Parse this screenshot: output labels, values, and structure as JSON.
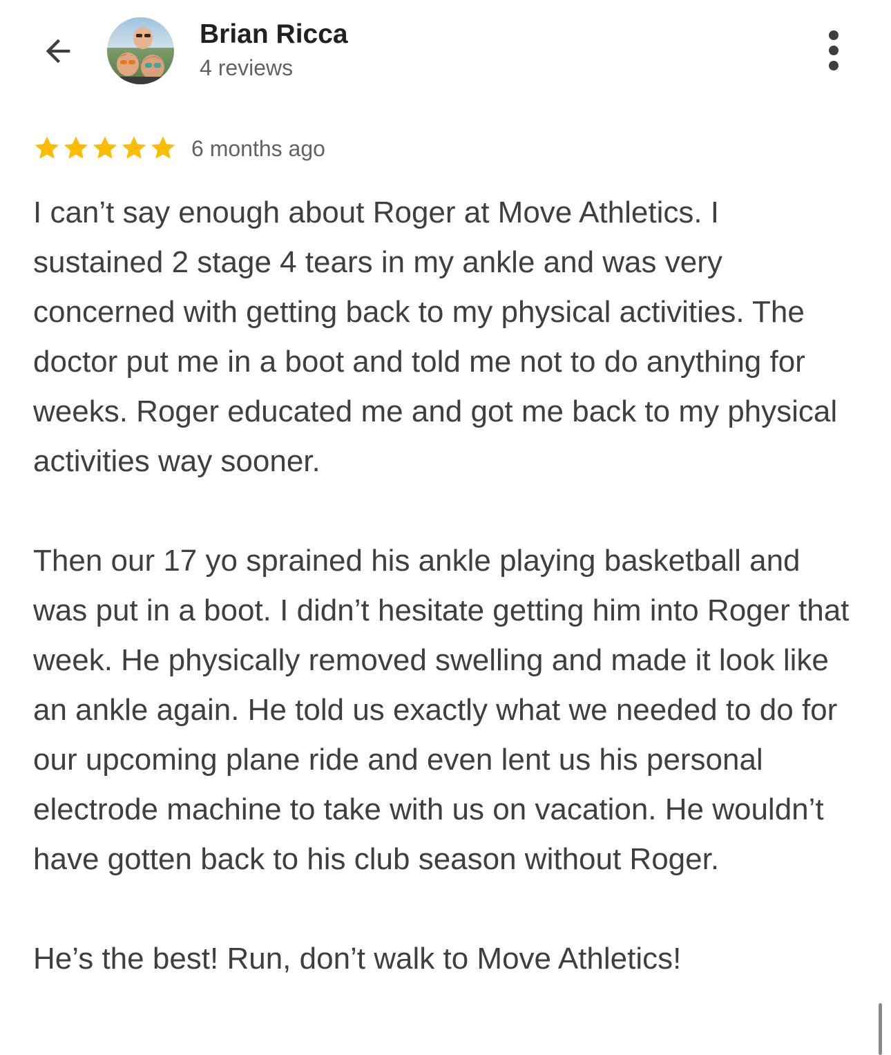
{
  "header": {
    "back_icon": "arrow-back-icon",
    "avatar_icon": "reviewer-avatar-photo",
    "name": "Brian Ricca",
    "review_count": "4 reviews",
    "more_icon": "more-vert-icon"
  },
  "review": {
    "rating": 5,
    "rating_max": 5,
    "star_color": "#fbbc04",
    "date": "6 months ago",
    "paragraphs": [
      "I can’t say enough about Roger at Move Athletics. I sustained 2 stage 4 tears in my ankle and was very concerned with getting back to my physical activities. The doctor put me in a boot and told me not to do anything for weeks. Roger educated me and got me back to my physical activities way sooner.",
      "Then our 17 yo sprained his ankle playing basketball and was put in a boot. I didn’t hesitate getting him into Roger that week. He physically removed swelling and made it look like an ankle again. He told us exactly what we needed to do for our upcoming plane ride and even lent us his personal electrode machine to take with us on vacation. He wouldn’t have gotten back to his club season without Roger.",
      "He’s the best! Run, don’t walk to Move Athletics!"
    ]
  },
  "colors": {
    "text_primary": "#202124",
    "text_body": "#3c4043",
    "text_secondary": "#5f6368"
  }
}
